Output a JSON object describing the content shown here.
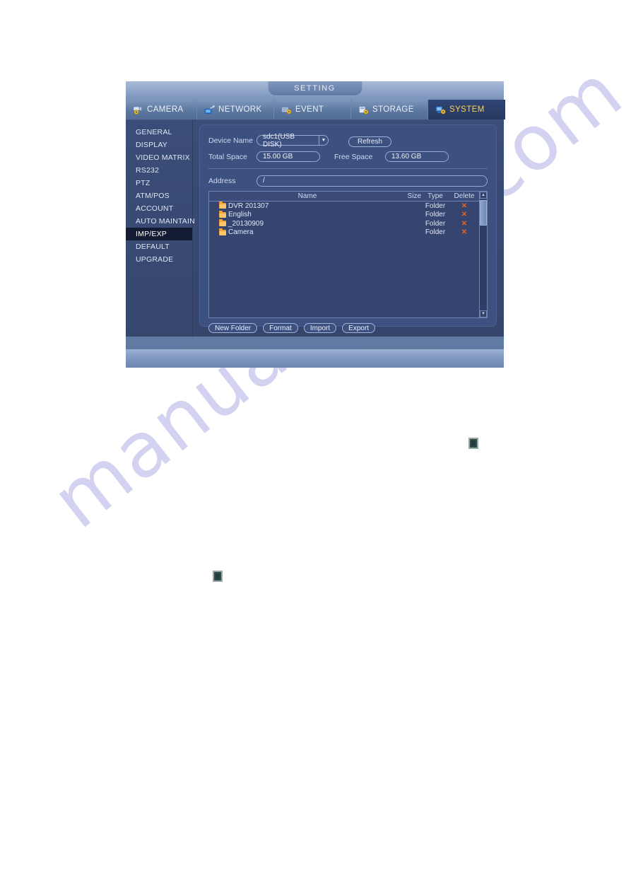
{
  "watermark": {
    "text": "manualshive.com"
  },
  "window": {
    "title": "SETTING"
  },
  "tabs": [
    {
      "label": "CAMERA",
      "icon": "camera-icon",
      "active": false
    },
    {
      "label": "NETWORK",
      "icon": "network-icon",
      "active": false
    },
    {
      "label": "EVENT",
      "icon": "event-icon",
      "active": false
    },
    {
      "label": "STORAGE",
      "icon": "storage-icon",
      "active": false
    },
    {
      "label": "SYSTEM",
      "icon": "system-icon",
      "active": true
    }
  ],
  "sidebar": {
    "items": [
      {
        "label": "GENERAL",
        "active": false
      },
      {
        "label": "DISPLAY",
        "active": false
      },
      {
        "label": "VIDEO MATRIX",
        "active": false
      },
      {
        "label": "RS232",
        "active": false
      },
      {
        "label": "PTZ",
        "active": false
      },
      {
        "label": "ATM/POS",
        "active": false
      },
      {
        "label": "ACCOUNT",
        "active": false
      },
      {
        "label": "AUTO MAINTAIN",
        "active": false
      },
      {
        "label": "IMP/EXP",
        "active": true
      },
      {
        "label": "DEFAULT",
        "active": false
      },
      {
        "label": "UPGRADE",
        "active": false
      }
    ]
  },
  "form": {
    "device_name_label": "Device Name",
    "device_name_value": "sdc1(USB DISK)",
    "total_space_label": "Total Space",
    "total_space_value": "15.00 GB",
    "free_space_label": "Free Space",
    "free_space_value": "13.60 GB",
    "refresh_label": "Refresh",
    "address_label": "Address",
    "address_value": "/"
  },
  "table": {
    "columns": {
      "name": "Name",
      "size": "Size",
      "type": "Type",
      "delete": "Delete"
    },
    "rows": [
      {
        "name": "DVR 201307",
        "size": "",
        "type": "Folder",
        "delete": "✕"
      },
      {
        "name": "English",
        "size": "",
        "type": "Folder",
        "delete": "✕"
      },
      {
        "name": "_20130909",
        "size": "",
        "type": "Folder",
        "delete": "✕"
      },
      {
        "name": "Camera",
        "size": "",
        "type": "Folder",
        "delete": "✕"
      }
    ]
  },
  "actions": {
    "new_folder": "New Folder",
    "format": "Format",
    "import": "Import",
    "export": "Export"
  },
  "colors": {
    "accent_active_tab_text": "#ffd24a",
    "delete_x": "#e8641e",
    "folder_icon": "#f0a63c",
    "panel_bg": "#3d5180",
    "watermark": "#d3d2f0"
  }
}
